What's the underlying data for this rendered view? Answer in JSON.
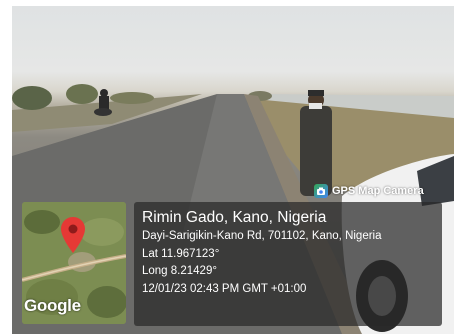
{
  "camera_badge": {
    "label": "GPS Map Camera",
    "icon": "gps-map-camera-icon"
  },
  "map": {
    "logo": "Google",
    "pin_icon": "map-pin-icon",
    "pin_color": "#e53935"
  },
  "location": {
    "place": "Rimin Gado, Kano, Nigeria",
    "address": "Dayi-Sarigikin-Kano Rd, 701102, Kano, Nigeria",
    "latitude": "Lat 11.967123°",
    "longitude": "Long 8.21429°",
    "timestamp": "12/01/23 02:43 PM GMT +01:00"
  },
  "colors": {
    "panel": "#282828",
    "text": "#ffffff"
  }
}
